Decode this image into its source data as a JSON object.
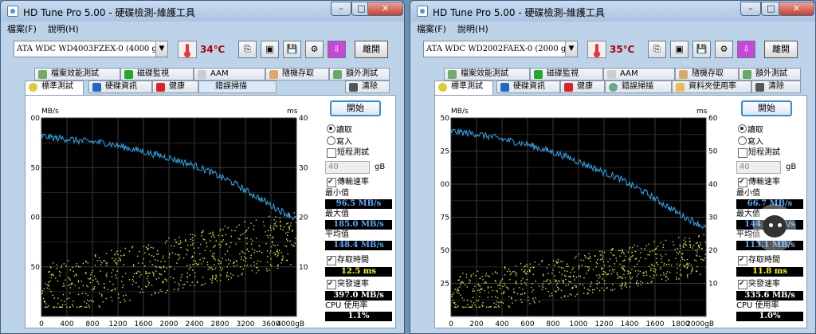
{
  "windows": [
    {
      "title": "HD Tune Pro  5.00 - 硬碟檢測-維護工具",
      "controls": {
        "min": "–",
        "max": "□",
        "close": "✕"
      },
      "menu": [
        "檔案(F)",
        "說明(H)"
      ],
      "drive": "ATA    WDC WD4003FZEX-0 (4000 gB)",
      "temperature": "34℃",
      "exit_label": "離開",
      "tabs_top": [
        "檔案效能測試",
        "磁碟監視",
        "AAM",
        "隨機存取",
        "額外測試"
      ],
      "tabs_bottom": [
        "標準測試",
        "硬碟資訊",
        "健康",
        "錯誤掃描",
        "清除"
      ],
      "start_label": "開始",
      "read_label": "讀取",
      "write_label": "寫入",
      "short_test_label": "短程測試",
      "spin_value": "40",
      "spin_unit": "gB",
      "transfer_label": "傳輸速率",
      "min_label": "最小值",
      "min_value": "96.5 MB/s",
      "max_label": "最大值",
      "max_value": "185.0 MB/s",
      "avg_label": "平均值",
      "avg_value": "148.4 MB/s",
      "access_label": "存取時間",
      "access_value": "12.5 ms",
      "burst_label": "突發速率",
      "burst_value": "397.0 MB/s",
      "cpu_label": "CPU 使用率",
      "cpu_value": "1.1%",
      "chart_labels": {
        "y_left": "MB/s",
        "y_right": "ms",
        "x_unit": "4000gB"
      }
    },
    {
      "title": "HD Tune Pro  5.00 - 硬碟檢測-維護工具",
      "controls": {
        "min": "–",
        "max": "□",
        "close": "✕"
      },
      "menu": [
        "檔案(F)",
        "說明(H)"
      ],
      "drive": "ATA    WDC WD2002FAEX-0 (2000 gB)",
      "temperature": "35℃",
      "exit_label": "離開",
      "tabs_top": [
        "檔案效能測試",
        "磁碟監視",
        "AAM",
        "隨機存取",
        "額外測試"
      ],
      "tabs_bottom": [
        "標準測試",
        "硬碟資訊",
        "健康",
        "錯誤掃描",
        "資料夾使用率",
        "清除"
      ],
      "start_label": "開始",
      "read_label": "讀取",
      "write_label": "寫入",
      "short_test_label": "短程測試",
      "spin_value": "40",
      "spin_unit": "gB",
      "transfer_label": "傳輸速率",
      "min_label": "最小值",
      "min_value": "66.7 MB/s",
      "max_label": "最大值",
      "max_value": "144.6 MB/s",
      "avg_label": "平均值",
      "avg_value": "113.1 MB/s",
      "access_label": "存取時間",
      "access_value": "11.8 ms",
      "burst_label": "突發速率",
      "burst_value": "335.6 MB/s",
      "cpu_label": "CPU 使用率",
      "cpu_value": "1.0%",
      "chart_labels": {
        "y_left": "MB/s",
        "y_right": "ms",
        "x_unit": "2000gB"
      }
    }
  ],
  "chart_data": [
    {
      "type": "line",
      "ylabel": "MB/s",
      "y2label": "ms",
      "ylim": [
        0,
        200
      ],
      "y2lim": [
        0,
        40
      ],
      "xlim": [
        0,
        4000
      ],
      "x_ticks": [
        "0",
        "400",
        "800",
        "1200",
        "1600",
        "2000",
        "2400",
        "2800",
        "3200",
        "3600",
        "4000gB"
      ],
      "y_ticks": [
        50,
        100,
        150,
        200
      ],
      "y2_ticks": [
        10,
        20,
        30,
        40
      ],
      "grid": true,
      "series": [
        {
          "name": "傳輸速率",
          "color": "#2aa8e8",
          "x": [
            0,
            200,
            400,
            600,
            800,
            1000,
            1200,
            1400,
            1600,
            1800,
            2000,
            2200,
            2400,
            2600,
            2800,
            3000,
            3200,
            3400,
            3600,
            3800,
            4000
          ],
          "y": [
            182,
            180,
            179,
            177,
            176,
            175,
            172,
            169,
            166,
            163,
            160,
            156,
            152,
            147,
            141,
            135,
            127,
            120,
            112,
            105,
            98
          ]
        },
        {
          "name": "存取時間",
          "color": "#e0e030",
          "type": "scatter",
          "access_min": 2,
          "access_max": 22
        }
      ]
    },
    {
      "type": "line",
      "ylabel": "MB/s",
      "y2label": "ms",
      "ylim": [
        0,
        150
      ],
      "y2lim": [
        0,
        60
      ],
      "xlim": [
        0,
        2000
      ],
      "x_ticks": [
        "0",
        "200",
        "400",
        "600",
        "800",
        "1000",
        "1200",
        "1400",
        "1600",
        "1800",
        "2000gB"
      ],
      "y_ticks": [
        25,
        50,
        75,
        100,
        125,
        150
      ],
      "y2_ticks": [
        10,
        20,
        30,
        40,
        50,
        60
      ],
      "grid": true,
      "series": [
        {
          "name": "傳輸速率",
          "color": "#2aa8e8",
          "x": [
            0,
            100,
            200,
            300,
            400,
            500,
            600,
            700,
            800,
            900,
            1000,
            1100,
            1200,
            1300,
            1400,
            1500,
            1600,
            1700,
            1800,
            1900,
            2000
          ],
          "y": [
            140,
            139,
            138,
            136,
            134,
            132,
            130,
            127,
            124,
            121,
            117,
            113,
            109,
            105,
            100,
            95,
            89,
            83,
            77,
            72,
            67
          ]
        },
        {
          "name": "存取時間",
          "color": "#e0e030",
          "type": "scatter",
          "access_min": 3,
          "access_max": 26
        }
      ]
    }
  ]
}
